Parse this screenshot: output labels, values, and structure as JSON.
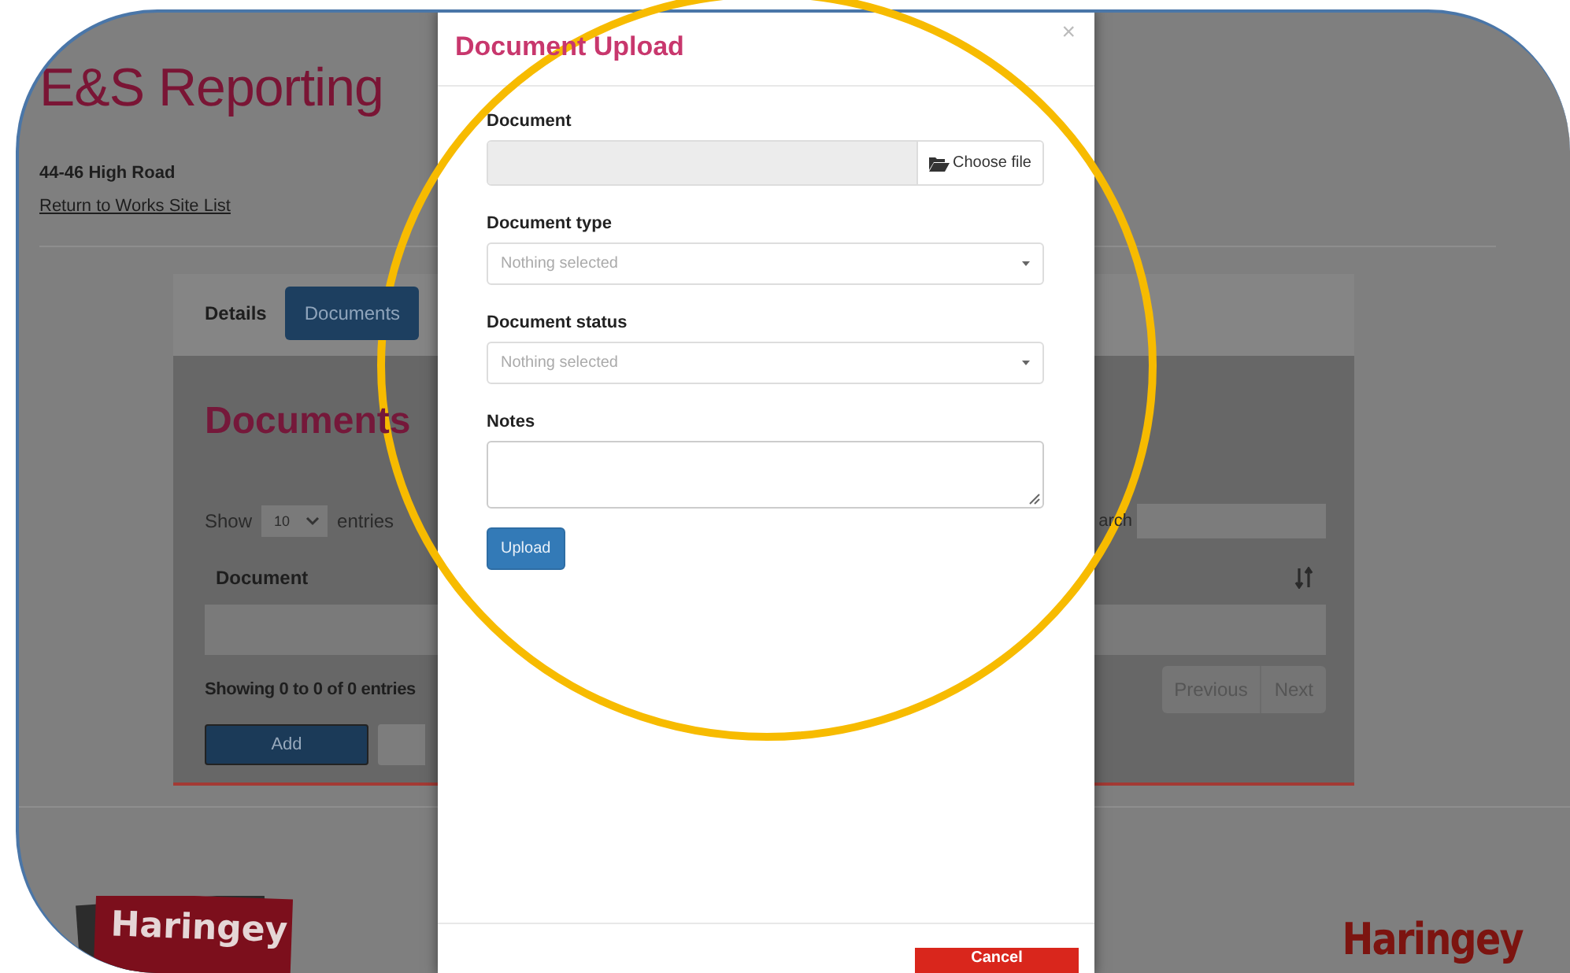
{
  "page": {
    "title": "E&S Reporting",
    "address": "44-46 High Road",
    "back_link": "Return to Works Site List",
    "tabs": [
      {
        "label": "Details",
        "selected": false
      },
      {
        "label": "Documents",
        "selected": true
      }
    ],
    "section_title": "Documents",
    "length_menu": {
      "before": "Show",
      "value": "10",
      "after": "entries"
    },
    "search_label": "arch",
    "table": {
      "columns": [
        "Document"
      ]
    },
    "info": "Showing 0 to 0 of 0 entries",
    "pagination": [
      "Previous",
      "Next"
    ],
    "add_button": "Add",
    "footer": {
      "logo_left": "Haringey",
      "logo_right": "Haringey"
    }
  },
  "modal": {
    "title": "Document Upload",
    "close": "×",
    "fields": [
      {
        "kind": "file",
        "label": "Document",
        "button": "Choose file"
      },
      {
        "kind": "select",
        "label": "Document type",
        "placeholder": "Nothing selected"
      },
      {
        "kind": "select",
        "label": "Document status",
        "placeholder": "Nothing selected"
      },
      {
        "kind": "textarea",
        "label": "Notes"
      }
    ],
    "submit": "Upload",
    "cancel": "Cancel"
  }
}
